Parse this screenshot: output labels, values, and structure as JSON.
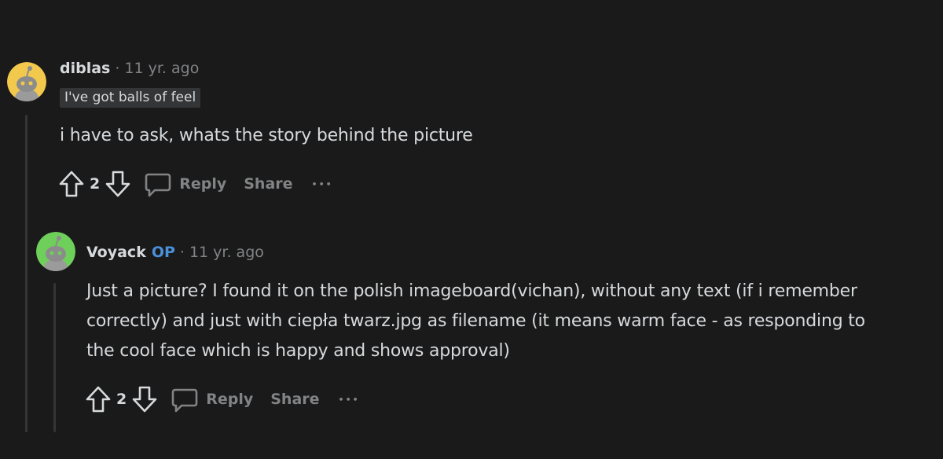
{
  "comments": [
    {
      "author": "diblas",
      "separator": "·",
      "time": "11 yr. ago",
      "flair": "I've got balls of feel",
      "body": "i have to ask, whats the story behind the picture",
      "score": "2",
      "reply_label": "Reply",
      "share_label": "Share",
      "more_label": "•••",
      "avatar_color": "#f2c94c"
    },
    {
      "author": "Voyack",
      "op_badge": "OP",
      "separator": "·",
      "time": "11 yr. ago",
      "body_lines": [
        "Just a picture? I found it on the polish imageboard(vichan), without any text (if i remember",
        "correctly) and just with ciepła twarz.jpg as filename (it means warm face - as responding to",
        "the cool face which is happy and shows approval)"
      ],
      "score": "2",
      "reply_label": "Reply",
      "share_label": "Share",
      "more_label": "•••",
      "avatar_color": "#6fcf5b"
    }
  ],
  "colors": {
    "background": "#1a1a1b",
    "text": "#d7dadc",
    "muted": "#818384",
    "op": "#4a90d9",
    "thread_line": "#343536"
  }
}
